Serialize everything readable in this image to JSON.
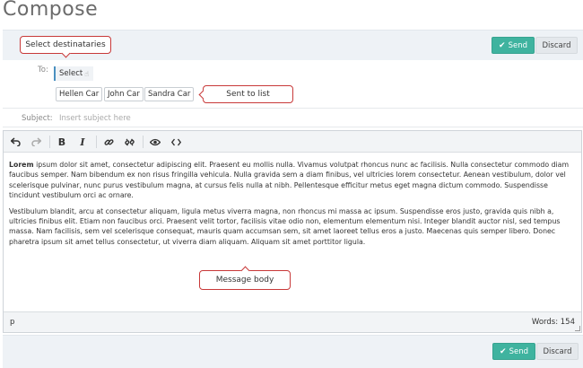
{
  "page": {
    "title": "Compose"
  },
  "actions": {
    "send_label": "Send",
    "discard_label": "Discard",
    "send_icon": "check-icon"
  },
  "callouts": {
    "select_destinataries": "Select destinataries",
    "sent_to_list": "Sent to list",
    "message_body": "Message body"
  },
  "recipients": {
    "to_label": "To:",
    "select_label": "Select",
    "list": [
      "Hellen Car",
      "John Car",
      "Sandra Car"
    ]
  },
  "subject": {
    "label": "Subject:",
    "placeholder": "Insert subject here",
    "value": ""
  },
  "toolbar": {
    "items": [
      "undo-icon",
      "redo-icon",
      "bold-icon",
      "italic-icon",
      "link-icon",
      "unlink-icon",
      "eye-icon",
      "code-icon"
    ],
    "bold_glyph": "B",
    "italic_glyph": "I"
  },
  "body": {
    "p1_bold": "Lorem",
    "p1_rest": " ipsum dolor sit amet, consectetur adipiscing elit. Praesent eu mollis nulla. Vivamus volutpat rhoncus nunc ac facilisis. Nulla consectetur commodo diam faucibus semper. Nam bibendum ex non risus fringilla vehicula. Nulla gravida sem a diam finibus, vel ultricies lorem consectetur. Aenean vestibulum, dolor vel scelerisque pulvinar, nunc purus vestibulum magna, at cursus felis nulla at nibh. Pellentesque efficitur metus eget magna dictum commodo. Suspendisse tincidunt vestibulum orci ac ornare.",
    "p2": "Vestibulum blandit, arcu at consectetur aliquam, ligula metus viverra magna, non rhoncus mi massa ac ipsum. Suspendisse eros justo, gravida quis nibh a, ultricies finibus elit. Etiam non faucibus orci. Praesent velit tortor, facilisis vitae odio non, elementum elementum nisi. Integer blandit auctor nisl, sed tempus massa. Nam facilisis, sem vel scelerisque consequat, mauris quam accumsan sem, sit amet laoreet tellus eros a justo. Maecenas quis semper libero. Donec pharetra ipsum sit amet tellus consectetur, ut viverra diam aliquam. Aliquam sit amet porttitor ligula."
  },
  "status": {
    "path": "p",
    "word_count": "Words: 154"
  },
  "colors": {
    "accent": "#3fb39f",
    "callout_border": "#c83939",
    "bar_bg": "#eef2f6"
  }
}
